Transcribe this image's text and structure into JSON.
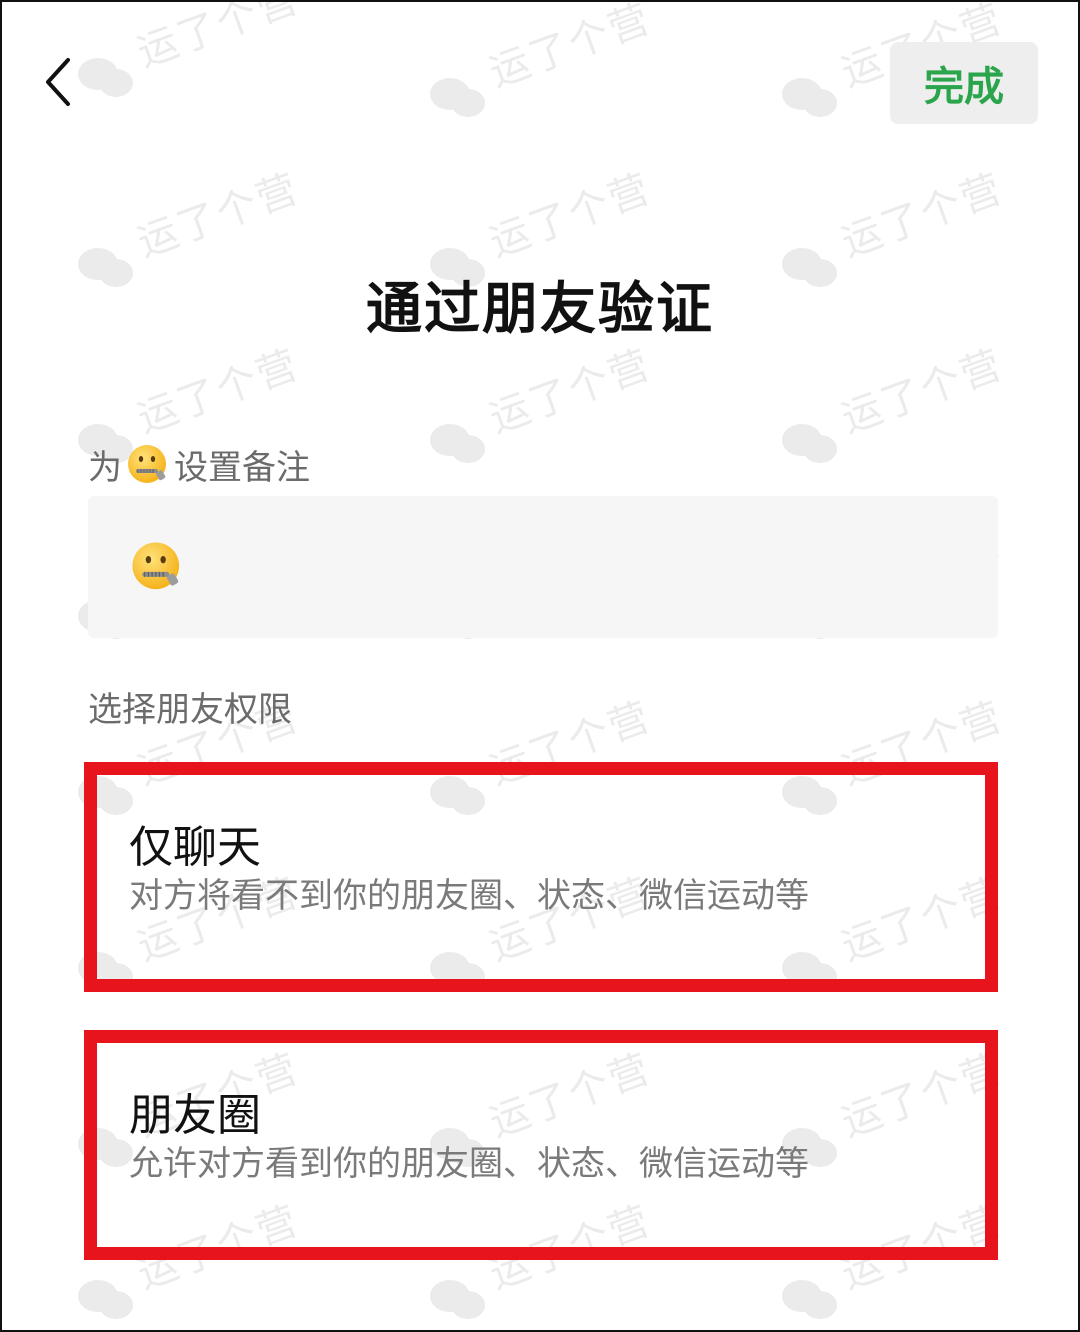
{
  "header": {
    "done_label": "完成"
  },
  "page": {
    "title": "通过朋友验证"
  },
  "remark": {
    "label_prefix": "为",
    "label_suffix": "设置备注"
  },
  "permissions": {
    "section_label": "选择朋友权限",
    "options": [
      {
        "title": "仅聊天",
        "desc": "对方将看不到你的朋友圈、状态、微信运动等"
      },
      {
        "title": "朋友圈",
        "desc": "允许对方看到你的朋友圈、状态、微信运动等"
      }
    ]
  },
  "watermark": {
    "text": "运了个营"
  },
  "icons": {
    "back": "chevron-left-icon",
    "avatar": "zipper-mouth-face-icon",
    "watermark_logo": "wechat-logo-icon"
  },
  "colors": {
    "accent_green": "#2aa54c",
    "highlight_red": "#e8141c",
    "button_bg": "#eeeeee"
  }
}
